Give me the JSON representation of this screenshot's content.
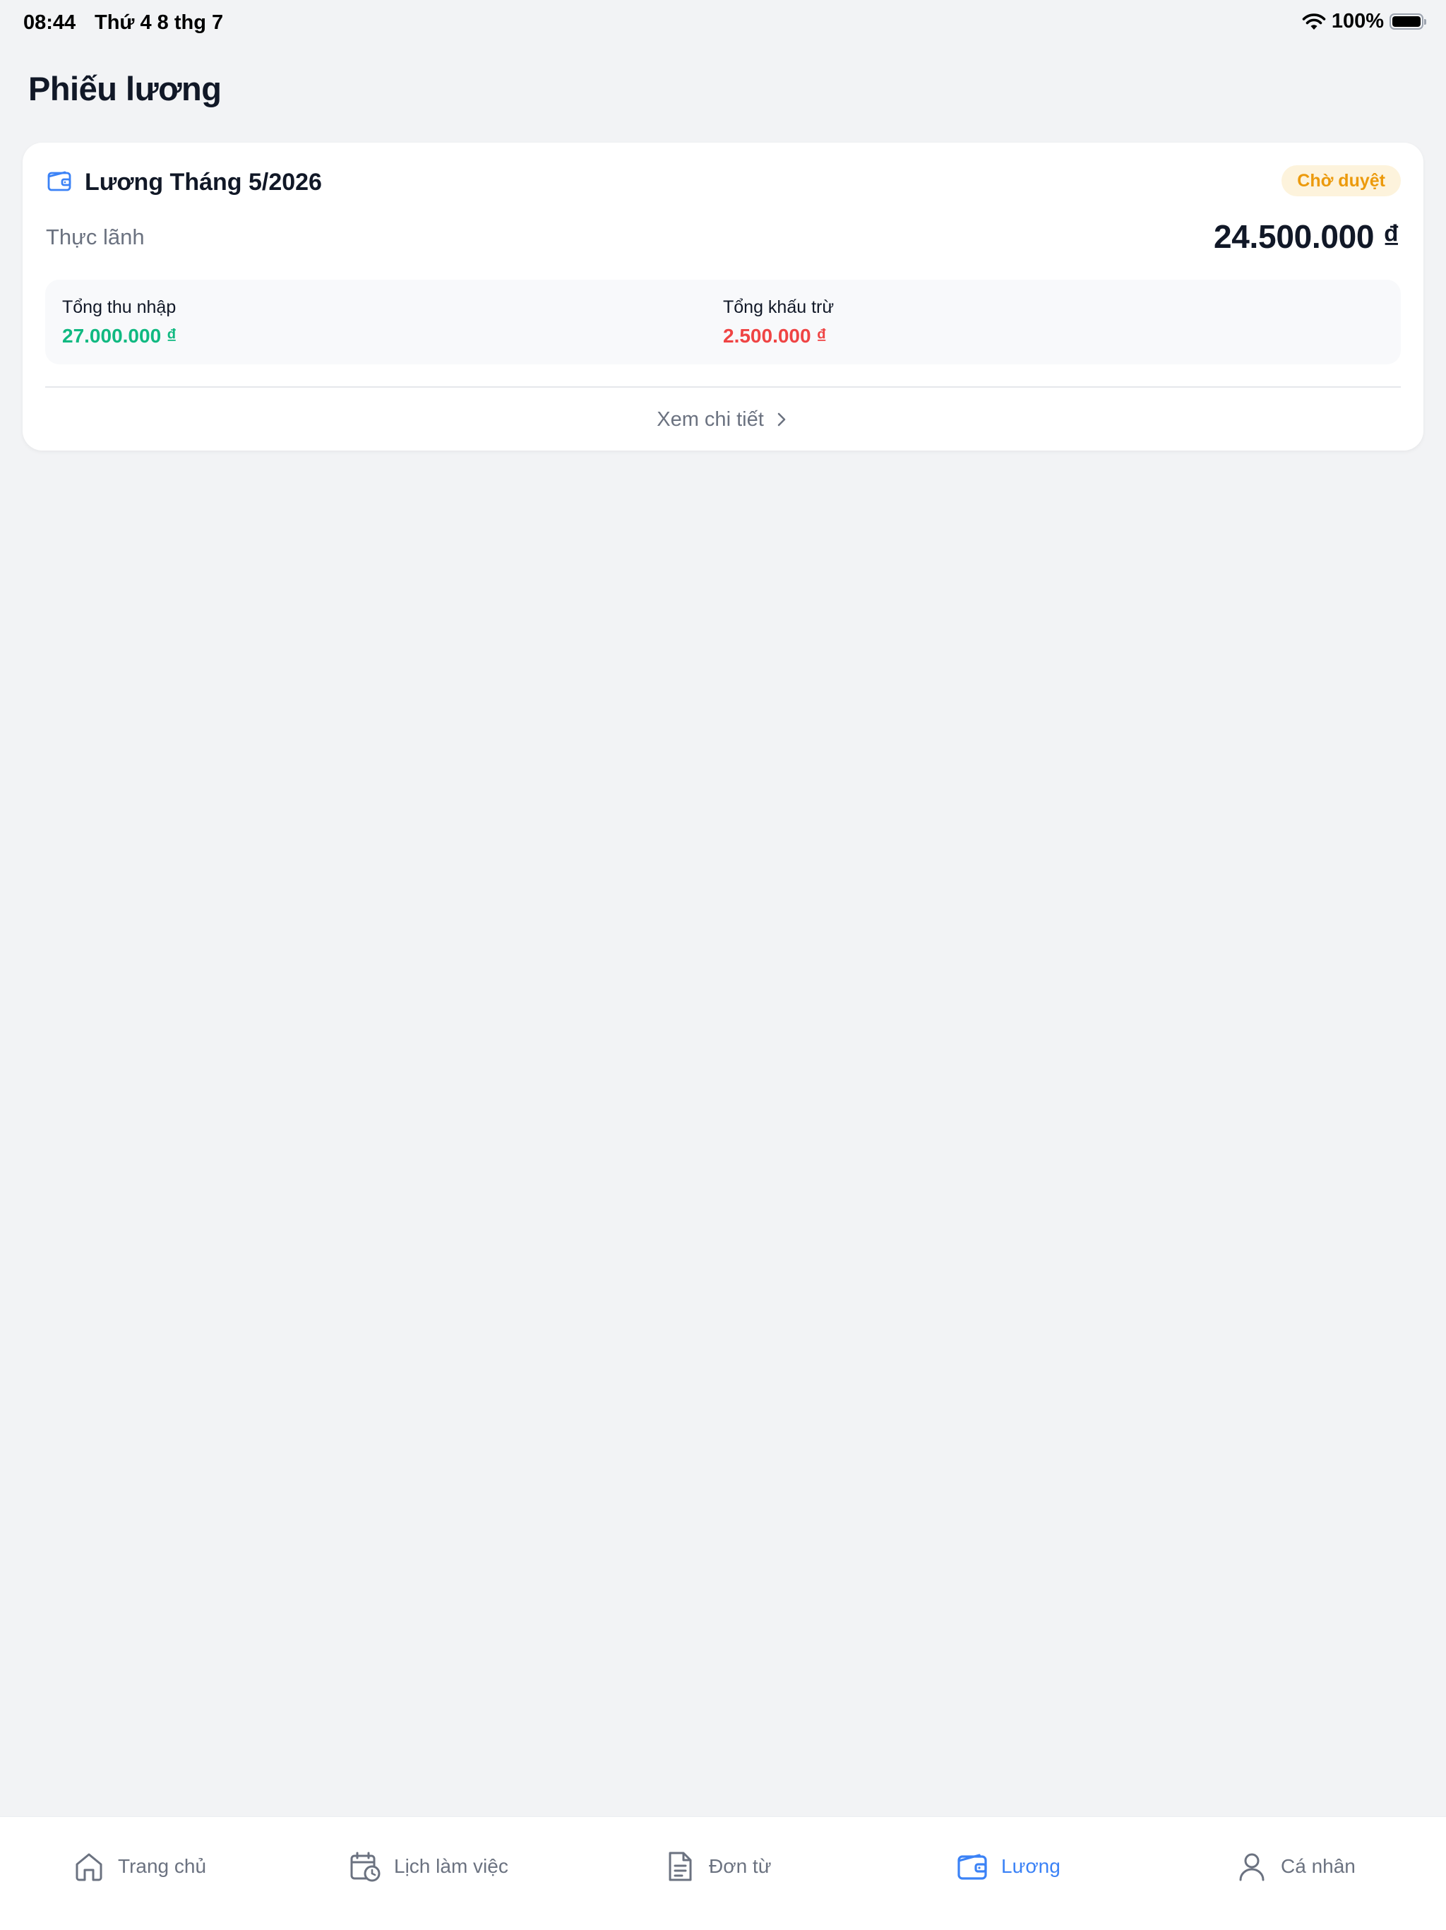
{
  "status_bar": {
    "time": "08:44",
    "date": "Thứ 4 8 thg 7",
    "battery": "100%",
    "battery_level": 1.0
  },
  "page": {
    "title": "Phiếu lương"
  },
  "payslip": {
    "title": "Lương Tháng 5/2026",
    "status": "Chờ duyệt",
    "net_label": "Thực lãnh",
    "net_value": "24.500.000 ₫",
    "income_label": "Tổng thu nhập",
    "income_value": "27.000.000 ₫",
    "deduction_label": "Tổng khấu trừ",
    "deduction_value": "2.500.000 ₫",
    "detail_link": "Xem chi tiết"
  },
  "bottom_nav": {
    "items": [
      {
        "label": "Trang chủ",
        "icon": "home-icon"
      },
      {
        "label": "Lịch làm việc",
        "icon": "calendar-clock-icon"
      },
      {
        "label": "Đơn từ",
        "icon": "document-icon"
      },
      {
        "label": "Lương",
        "icon": "wallet-icon",
        "active": true
      },
      {
        "label": "Cá nhân",
        "icon": "user-icon"
      }
    ]
  },
  "colors": {
    "accent": "#3b82f6",
    "income": "#10b981",
    "deduction": "#ef4444",
    "pending_badge_text": "#ec9a0c",
    "pending_badge_bg": "#fdf3dc",
    "background": "#f2f3f5"
  }
}
